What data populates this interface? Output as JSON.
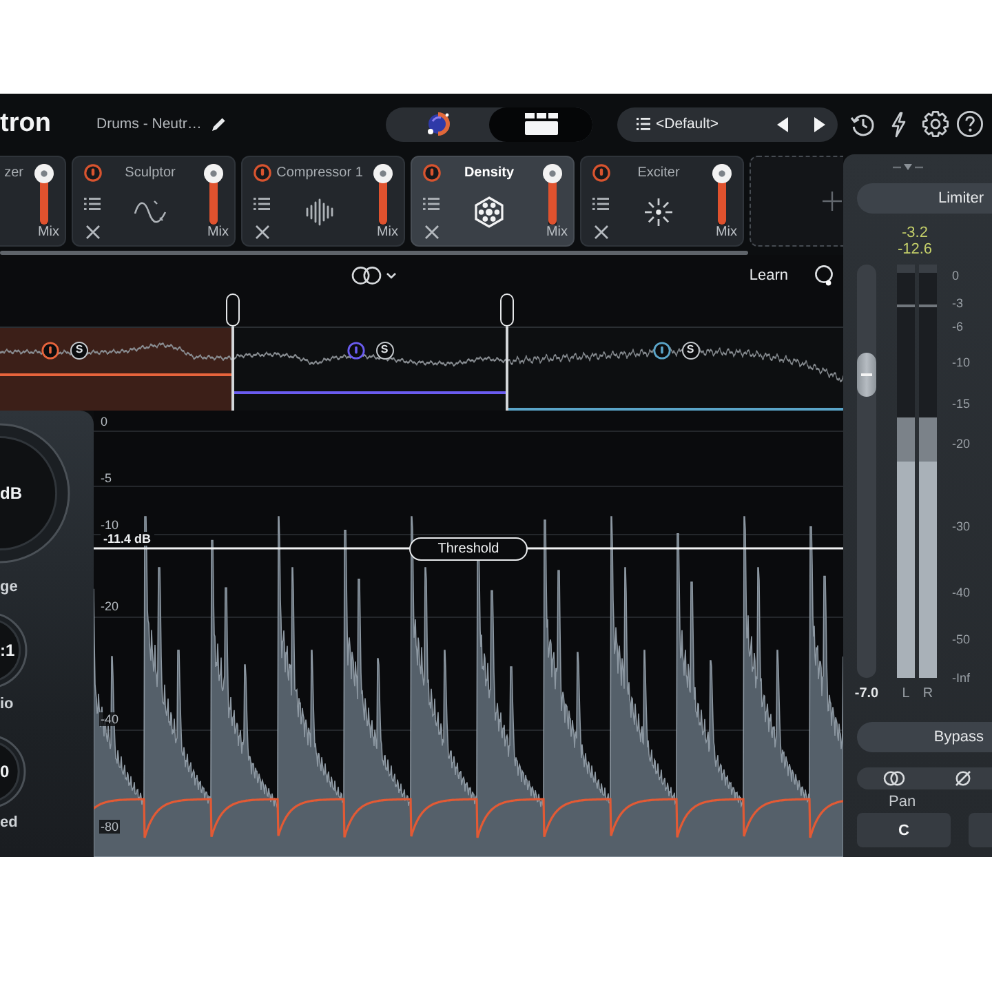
{
  "header": {
    "logo": "tron",
    "track_name": "Drums - Neutr…",
    "view_tabs": [
      {
        "kind": "assistant",
        "selected": false
      },
      {
        "kind": "modules",
        "selected": true
      }
    ],
    "preset": {
      "name": "<Default>"
    }
  },
  "modules": [
    {
      "title": "zer",
      "selected": false,
      "mix": {
        "label": "Mix",
        "level": 1
      }
    },
    {
      "kind": "sculptor",
      "title": "Sculptor",
      "power": true,
      "selected": false,
      "mix": {
        "label": "Mix",
        "level": 1
      }
    },
    {
      "kind": "compressor",
      "title": "Compressor 1",
      "power": true,
      "selected": false,
      "mix": {
        "label": "Mix",
        "level": 1
      }
    },
    {
      "kind": "density",
      "title": "Density",
      "power": true,
      "selected": true,
      "mix": {
        "label": "Mix",
        "level": 1
      }
    },
    {
      "kind": "exciter",
      "title": "Exciter",
      "power": true,
      "selected": false,
      "mix": {
        "label": "Mix",
        "level": 1
      }
    }
  ],
  "add_slot": true,
  "band_view": {
    "learn": "Learn",
    "bands": [
      {
        "color": "#e8643c",
        "selected": true,
        "solo": "S"
      },
      {
        "color": "#6a5cf0",
        "selected": false,
        "solo": "S"
      },
      {
        "color": "#5aa4c8",
        "selected": false,
        "solo": "S"
      }
    ]
  },
  "knobs": [
    {
      "value": "dB",
      "label": "ge"
    },
    {
      "value": ":1",
      "label": "io"
    },
    {
      "value": "0",
      "label": "ed"
    }
  ],
  "graph": {
    "scale": [
      "0",
      "-5",
      "-10",
      "-20",
      "-40",
      "-80"
    ],
    "threshold": {
      "value": "-11.4 dB",
      "label": "Threshold"
    }
  },
  "output": {
    "mode": "Limiter",
    "readings": [
      "-3.2",
      "-12.6"
    ],
    "gain": {
      "level": 0.76,
      "reading": "-7.0"
    },
    "meters": [
      {
        "label": "L",
        "level": 0.63
      },
      {
        "label": "R",
        "level": 0.63
      }
    ],
    "scale": [
      "0",
      "-3",
      "-6",
      "-10",
      "-15",
      "-20",
      "-30",
      "-40",
      "-50",
      "-Inf"
    ],
    "bypass": "Bypass",
    "pan": {
      "label": "Pan",
      "value": "C"
    }
  }
}
